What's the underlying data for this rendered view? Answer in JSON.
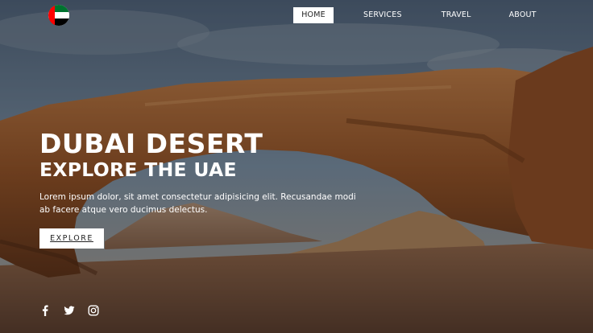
{
  "brand": {
    "logo_icon": "uae-flag-icon",
    "flag_colors": [
      "#00732f",
      "#ffffff",
      "#000000",
      "#ff0000"
    ]
  },
  "nav": {
    "items": [
      {
        "label": "HOME",
        "active": true
      },
      {
        "label": "SERVICES",
        "active": false
      },
      {
        "label": "TRAVEL",
        "active": false
      },
      {
        "label": "ABOUT",
        "active": false
      }
    ]
  },
  "hero": {
    "title": "DUBAI DESERT",
    "subtitle": "EXPLORE THE UAE",
    "description": "Lorem ipsum dolor, sit amet consectetur adipisicing elit. Recusandae modi ab facere atque vero ducimus delectus.",
    "cta_label": "EXPLORE"
  },
  "social": {
    "icons": [
      "facebook-icon",
      "twitter-icon",
      "instagram-icon"
    ]
  },
  "colors": {
    "accent": "#ffffff",
    "overlay": "rgba(0,0,0,0.36)",
    "rock": "#b06a3a",
    "sky": "#6f8aa6"
  }
}
